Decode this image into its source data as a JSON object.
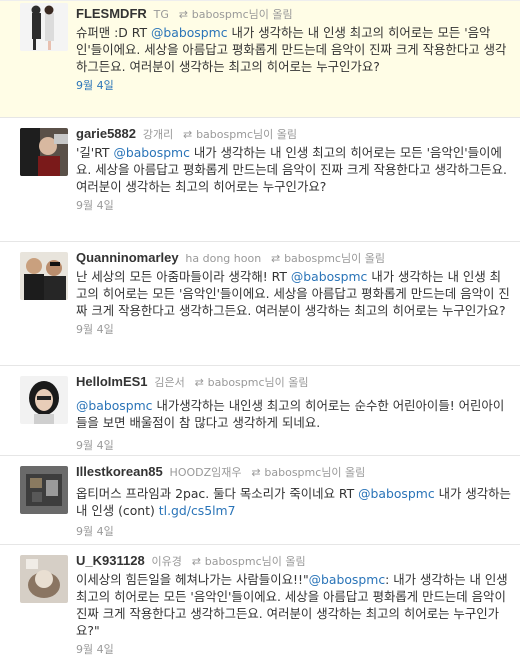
{
  "tweets": [
    {
      "username": "FLESMDFR",
      "fullname": "TG",
      "retweeted_by": "babospmc",
      "retweeted_suffix": "님이 올림",
      "text_before": "슈퍼맨 :D RT ",
      "mention": "@babospmc",
      "text_after": " 내가 생각하는 내 인생 최고의 히어로는 모든 '음악인'들이에요. 세상을 아름답고 평화롭게 만드는데 음악이 진짜 크게 작용한다고 생각하그든요. 여러분이 생각하는 최고의 히어로는 누구인가요?",
      "time": "9월 4일"
    },
    {
      "username": "garie5882",
      "fullname": "강개리",
      "retweeted_by": "babospmc",
      "retweeted_suffix": "님이 올림",
      "text_before": "'길'RT ",
      "mention": "@babospmc",
      "text_after": " 내가 생각하는 내 인생 최고의 히어로는 모든 '음악인'들이에요. 세상을 아름답고 평화롭게 만드는데 음악이 진짜 크게 작용한다고 생각하그든요. 여러분이 생각하는 최고의 히어로는 누구인가요?",
      "time": "9월 4일"
    },
    {
      "username": "Quanninomarley",
      "fullname": "ha dong hoon",
      "retweeted_by": "babospmc",
      "retweeted_suffix": "님이 올림",
      "text_before": "난 세상의 모든 아줌마들이라 생각해! RT ",
      "mention": "@babospmc",
      "text_after": " 내가 생각하는 내 인생 최고의 히어로는 모든 '음악인'들이에요. 세상을 아름답고 평화롭게 만드는데 음악이 진짜 크게 작용한다고 생각하그든요. 여러분이 생각하는 최고의 히어로는 누구인가요?",
      "time": "9월 4일"
    },
    {
      "username": "HelloImES1",
      "fullname": "김은서",
      "retweeted_by": "babospmc",
      "retweeted_suffix": "님이 올림",
      "text_before": "",
      "mention": "@babospmc",
      "text_after": " 내가생각하는 내인생 최고의 히어로는 순수한 어린아이들! 어린아이들을 보면 배울점이 참 많다고 생각하게 되네요.",
      "time": "9월 4일"
    },
    {
      "username": "Illestkorean85",
      "fullname": "HOODZ임재우",
      "retweeted_by": "babospmc",
      "retweeted_suffix": "님이 올림",
      "text_before": "옵티머스 프라임과 2pac. 둘다 목소리가 죽이네요 RT ",
      "mention": "@babospmc",
      "text_after": " 내가 생각하는 내 인생 (cont) ",
      "link": "tl.gd/cs5lm7",
      "time": "9월 4일"
    },
    {
      "username": "U_K931128",
      "fullname": "이유경",
      "retweeted_by": "babospmc",
      "retweeted_suffix": "님이 올림",
      "text_before": "이세상의 힘든일을 헤쳐나가는 사람들이요!!\"",
      "mention": "@babospmc",
      "text_after": ": 내가 생각하는 내 인생 최고의 히어로는 모든 '음악인'들이에요. 세상을 아름답고 평화롭게 만드는데 음악이 진짜 크게 작용한다고 생각하그든요. 여러분이 생각하는 최고의 히어로는 누구인가요?\"",
      "time": "9월 4일"
    }
  ],
  "icons": {
    "retweet": "retweet-icon"
  },
  "colors": {
    "link": "#2a74b8",
    "highlight": "#fffde6",
    "meta": "#999999"
  }
}
